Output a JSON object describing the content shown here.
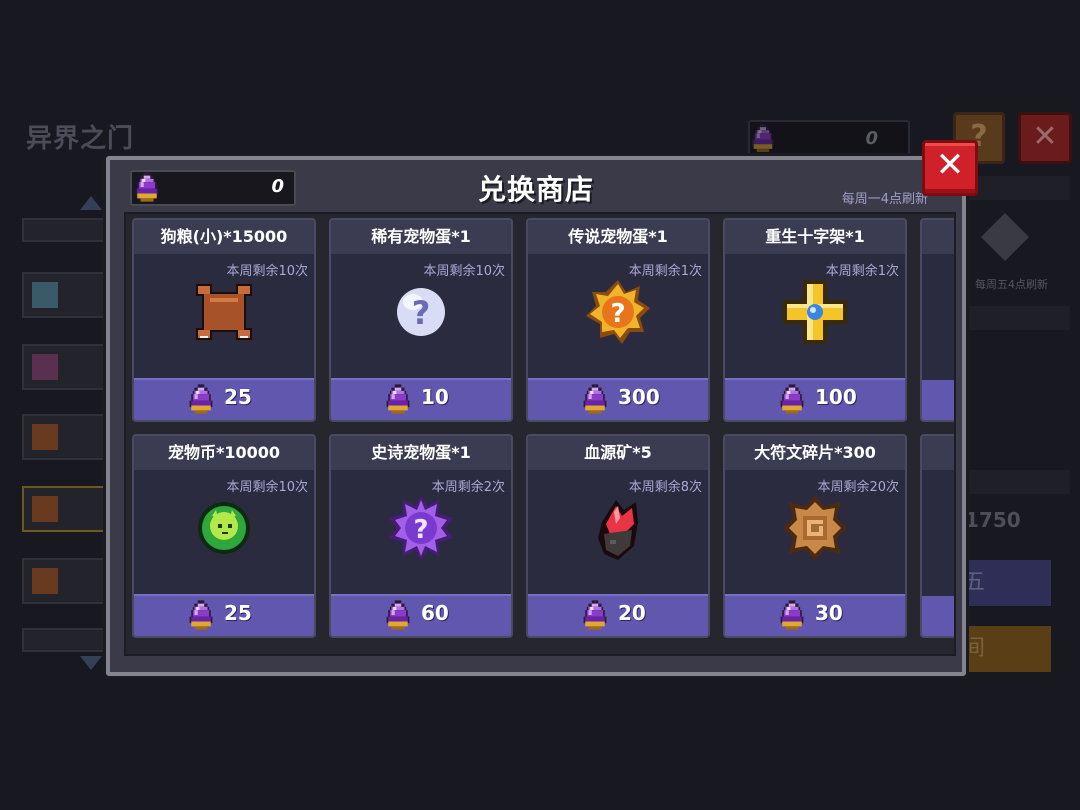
{
  "background": {
    "title": "异界之门",
    "currency_value": "0",
    "help_label": "?",
    "close_label": "✕",
    "right_refresh_note": "每周五4点刷新",
    "right_number": "1750",
    "button_a_label": "五",
    "button_b_label": "间"
  },
  "shop": {
    "title": "兑换商店",
    "currency_value": "0",
    "refresh_note": "每周一4点刷新",
    "close_label": "✕",
    "items": [
      {
        "name": "狗粮(小)*15000",
        "limit": "本周剩余10次",
        "price": "25",
        "icon": "dog-food-icon"
      },
      {
        "name": "稀有宠物蛋*1",
        "limit": "本周剩余10次",
        "price": "10",
        "icon": "rare-pet-egg-icon"
      },
      {
        "name": "传说宠物蛋*1",
        "limit": "本周剩余1次",
        "price": "300",
        "icon": "legendary-pet-egg-icon"
      },
      {
        "name": "重生十字架*1",
        "limit": "本周剩余1次",
        "price": "100",
        "icon": "rebirth-cross-icon"
      },
      {
        "name": "宠物币*10000",
        "limit": "本周剩余10次",
        "price": "25",
        "icon": "pet-coin-icon"
      },
      {
        "name": "史诗宠物蛋*1",
        "limit": "本周剩余2次",
        "price": "60",
        "icon": "epic-pet-egg-icon"
      },
      {
        "name": "血源矿*5",
        "limit": "本周剩余8次",
        "price": "20",
        "icon": "blood-ore-icon"
      },
      {
        "name": "大符文碎片*300",
        "limit": "本周剩余20次",
        "price": "30",
        "icon": "rune-fragment-icon"
      }
    ]
  },
  "colors": {
    "price_bar": "#6157ae",
    "card_bg": "#2b2b40",
    "close_red": "#d0212a",
    "limit_text": "#a8a8d4"
  }
}
